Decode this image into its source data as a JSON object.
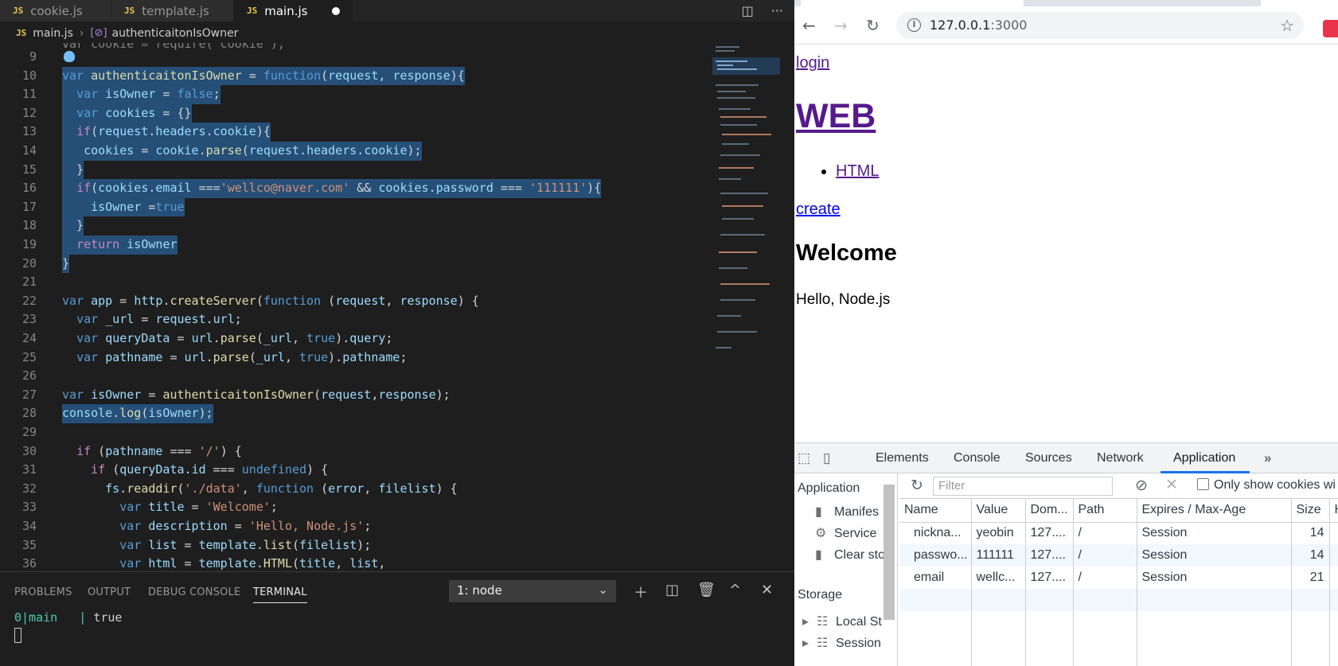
{
  "editor": {
    "tabs": [
      {
        "lang": "JS",
        "label": "cookie.js"
      },
      {
        "lang": "JS",
        "label": "template.js"
      },
      {
        "lang": "JS",
        "label": "main.js"
      }
    ],
    "breadcrumb": {
      "file": "main.js",
      "symbol": "authenticaitonIsOwner"
    },
    "line_numbers": [
      "9",
      "10",
      "11",
      "12",
      "13",
      "14",
      "15",
      "16",
      "17",
      "18",
      "19",
      "20",
      "21",
      "22",
      "23",
      "24",
      "25",
      "26",
      "27",
      "28",
      "29",
      "30",
      "31",
      "32",
      "33",
      "34",
      "35",
      "36"
    ],
    "partial_top_line": "var cookie = require('cookie');"
  },
  "panel": {
    "tabs": [
      "PROBLEMS",
      "OUTPUT",
      "DEBUG CONSOLE",
      "TERMINAL"
    ],
    "terminal_select": "1: node",
    "output_prefix": "0|main",
    "output_value": "true"
  },
  "browser": {
    "url_host": "127.0.0.1",
    "url_port": ":3000",
    "page": {
      "login": "login",
      "title": "WEB",
      "list": [
        "HTML"
      ],
      "create": "create",
      "heading": "Welcome",
      "description": "Hello, Node.js"
    }
  },
  "devtools": {
    "tabs": [
      "Elements",
      "Console",
      "Sources",
      "Network",
      "Application"
    ],
    "sidebar": {
      "app_header": "Application",
      "items": [
        "Manifes",
        "Service",
        "Clear sto"
      ],
      "storage_header": "Storage",
      "storage_items": [
        "Local St",
        "Session"
      ]
    },
    "filter_placeholder": "Filter",
    "only_cookies_label": "Only show cookies wi",
    "columns": [
      "Name",
      "Value",
      "Dom...",
      "Path",
      "Expires / Max-Age",
      "Size",
      "H"
    ],
    "rows": [
      [
        "nickna...",
        "yeobin",
        "127....",
        "/",
        "Session",
        "14"
      ],
      [
        "passwo...",
        "111111",
        "127....",
        "/",
        "Session",
        "14"
      ],
      [
        "email",
        "wellc...",
        "127....",
        "/",
        "Session",
        "21"
      ]
    ]
  },
  "colors": {
    "editor_bg": "#1e1e1e",
    "selection": "#264f78",
    "keyword": "#569cd6",
    "function": "#dcdcaa",
    "variable": "#9cdcfe",
    "string": "#ce9178",
    "link_visited": "#551a8b",
    "link": "#0000ee",
    "devtools_accent": "#1a73e8"
  }
}
